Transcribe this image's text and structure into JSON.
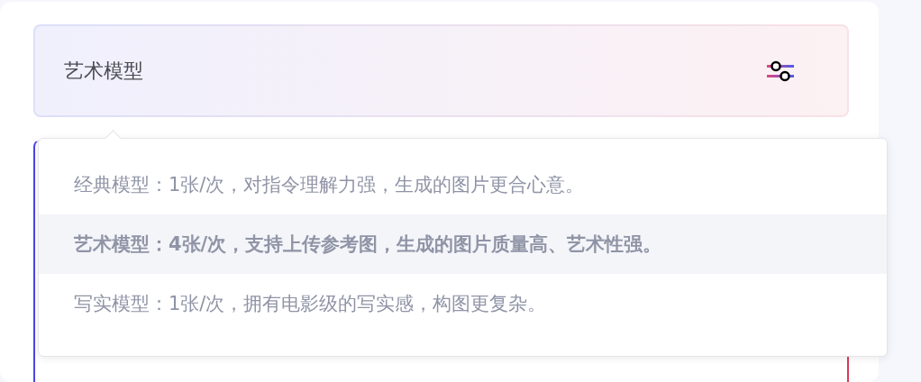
{
  "model_select": {
    "value": "艺术模型"
  },
  "dropdown": {
    "options": [
      {
        "label": "经典模型：1张/次，对指令理解力强，生成的图片更合心意。",
        "selected": false
      },
      {
        "label": "艺术模型：4张/次，支持上传参考图，生成的图片质量高、艺术性强。",
        "selected": true
      },
      {
        "label": "写实模型：1张/次，拥有电影级的写实感，构图更复杂。",
        "selected": false
      }
    ]
  }
}
